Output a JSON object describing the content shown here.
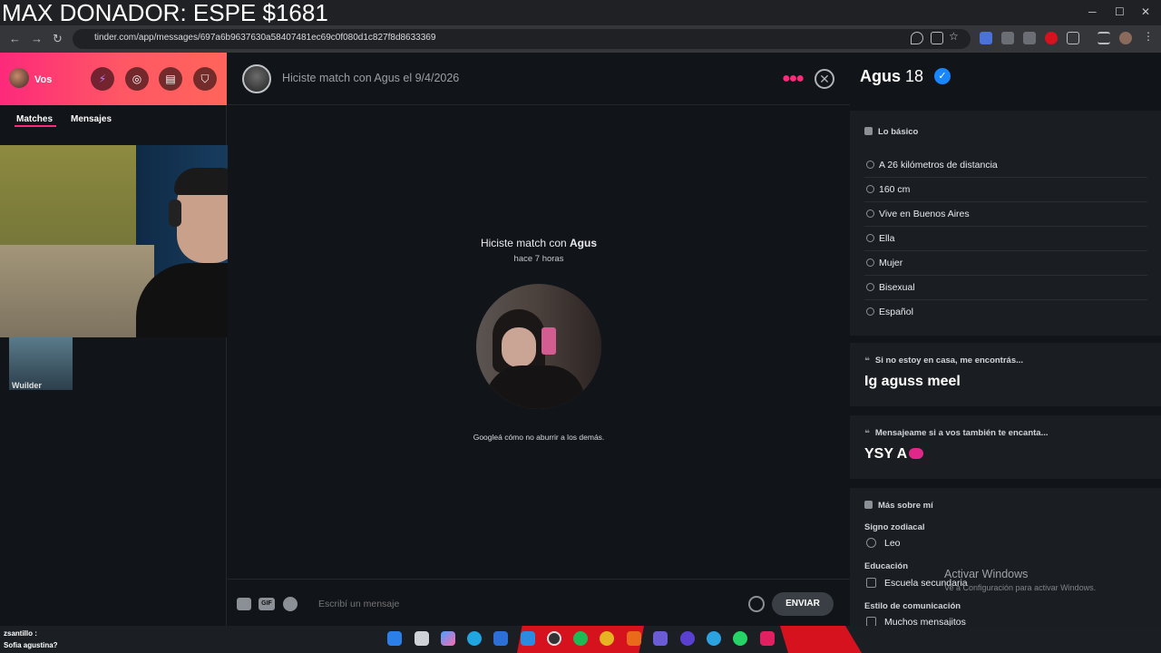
{
  "overlay": {
    "donor_text": "MAX DONADOR: ESPE $1681"
  },
  "browser": {
    "url": "tinder.com/app/messages/697a6b9637630a58407481ec69c0f080d1c827f8d8633369",
    "minimize": "─",
    "maximize": "☐",
    "close": "✕",
    "back": "←",
    "forward": "→",
    "reload": "↻"
  },
  "sidebar": {
    "user_label": "Vos",
    "tabs": [
      {
        "label": "Matches"
      },
      {
        "label": "Mensajes"
      }
    ],
    "guest_name": "Wuilder"
  },
  "chat": {
    "header_text": "Hiciste match con Agus el 9/4/2026",
    "match_prefix": "Hiciste match con ",
    "match_name": "Agus",
    "match_time": "hace 7 horas",
    "tip": "Googleá cómo no aburrir a los demás.",
    "gif_label": "GIF",
    "placeholder": "Escribí un mensaje",
    "send_label": "ENVIAR"
  },
  "profile": {
    "name": "Agus",
    "age": "18",
    "basics_title": "Lo básico",
    "basics": [
      {
        "icon": "location-icon",
        "text": "A 26 kilómetros de distancia"
      },
      {
        "icon": "ruler-icon",
        "text": "160 cm"
      },
      {
        "icon": "home-icon",
        "text": "Vive en Buenos Aires"
      },
      {
        "icon": "pronoun-icon",
        "text": "Ella"
      },
      {
        "icon": "person-icon",
        "text": "Mujer"
      },
      {
        "icon": "orientation-icon",
        "text": "Bisexual"
      },
      {
        "icon": "language-icon",
        "text": "Español"
      }
    ],
    "prompt1_q": "Si no estoy en casa, me encontrás...",
    "prompt1_a": "Ig aguss meel",
    "prompt2_q": "Mensajeame si a vos también te encanta...",
    "prompt2_a": "YSY A",
    "more_title": "Más sobre mí",
    "zodiac_label": "Signo zodiacal",
    "zodiac_value": "Leo",
    "education_label": "Educación",
    "education_value": "Escuela secundaria",
    "comm_label": "Estilo de comunicación",
    "comm_value": "Muchos mensajitos"
  },
  "windows": {
    "activate_title": "Activar Windows",
    "activate_sub": "Ve a Configuración para activar Windows."
  },
  "stream_chat": {
    "line1_user": "zsantillo :",
    "line2": "Sofia agustina?"
  },
  "colors": {
    "brand_pink": "#fd297b",
    "brand_orange": "#ff655b",
    "verified_blue": "#1786ff"
  }
}
